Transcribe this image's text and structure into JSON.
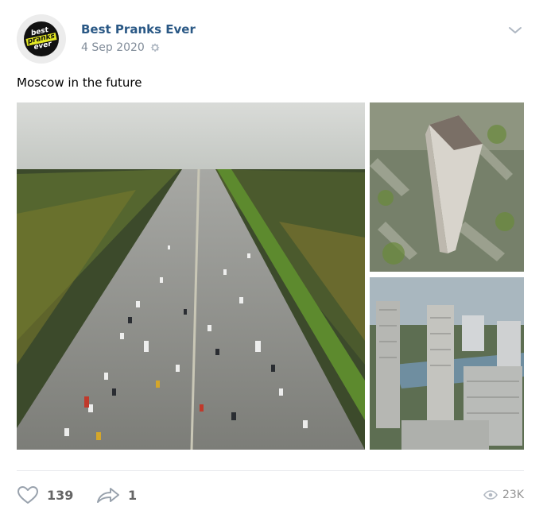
{
  "post": {
    "author": "Best Pranks Ever",
    "date": "4 Sep 2020",
    "text": "Moscow in the future",
    "avatar": {
      "line1": "best",
      "line2": "pranks",
      "line3": "ever"
    }
  },
  "footer": {
    "likes": "139",
    "shares": "1",
    "views": "23K"
  },
  "colors": {
    "author_link": "#2a5885",
    "meta_grey": "#818c99",
    "divider": "#e7e8ec"
  },
  "icons": [
    "gear-icon",
    "chevron-down-icon",
    "heart-icon",
    "share-arrow-icon",
    "eye-icon"
  ]
}
